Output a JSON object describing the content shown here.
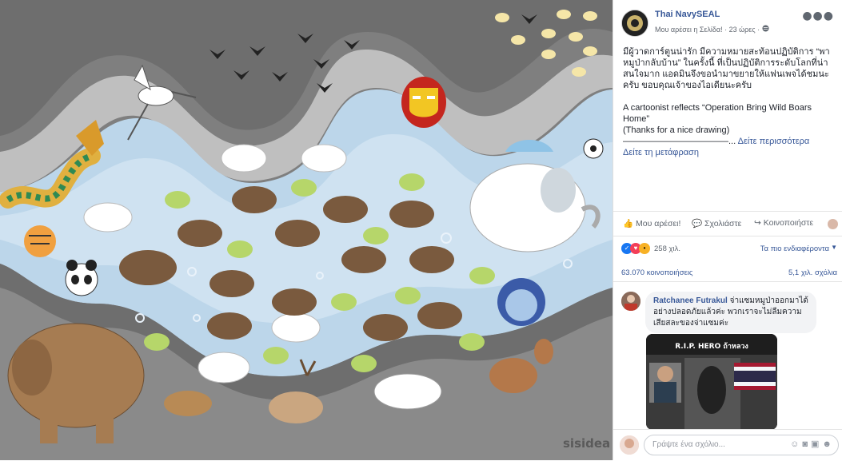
{
  "photo": {
    "watermark": "sisidea",
    "ironman_icon": "ironman-helmet-icon",
    "soccer_icon": "soccer-ball-icon"
  },
  "post": {
    "page_name": "Thai NavySEAL",
    "liked_label": "Μου αρέσει η Σελίδα!",
    "time": "23 ώρες",
    "privacy_icon": "globe-icon",
    "thai_text": "มีผู้วาดการ์ตูนน่ารัก มีความหมายสะท้อนปฏิบัติการ “พาหมูป่ากลับบ้าน” ในครั้งนี้ ที่เป็นปฏิบัติการระดับโลกที่น่าสนใจมาก แอดมินจึงขอนำมาขยายให้แฟนเพจได้ชมนะครับ ขอบคุณเจ้าของไอเดียนะครับ",
    "english_line1": "A cartoonist reflects “Operation Bring Wild Boars Home”",
    "english_line2": "(Thanks for a nice drawing)",
    "dashes": "————————————...",
    "see_more": "Δείτε περισσότερα",
    "see_translation": "Δείτε τη μετάφραση"
  },
  "actions": {
    "like": "Μου αρέσει!",
    "comment": "Σχολιάστε",
    "share": "Κοινοποιήστε"
  },
  "stats": {
    "reactions_count": "258 χιλ.",
    "most_relevant": "Τα πιο ενδιαφέροντα",
    "shares": "63.070 κοινοποιήσεις",
    "comments": "5,1 χιλ. σχόλια"
  },
  "comment": {
    "author": "Ratchanee Futrakul",
    "text": "จ่าแซมหมูป่าออกมาได้อย่างปลอดภัยแล้วค่ะ พวกเราจะไม่ลืมความเสียสละของจ่าแซมค่ะ",
    "image_title": "R.I.P. HERO ถ้าหลวง"
  },
  "composer": {
    "placeholder": "Γράψτε ένα σχόλιο..."
  },
  "colors": {
    "link": "#385898",
    "background_gray": "#808080",
    "water": "#bcd6ea"
  }
}
